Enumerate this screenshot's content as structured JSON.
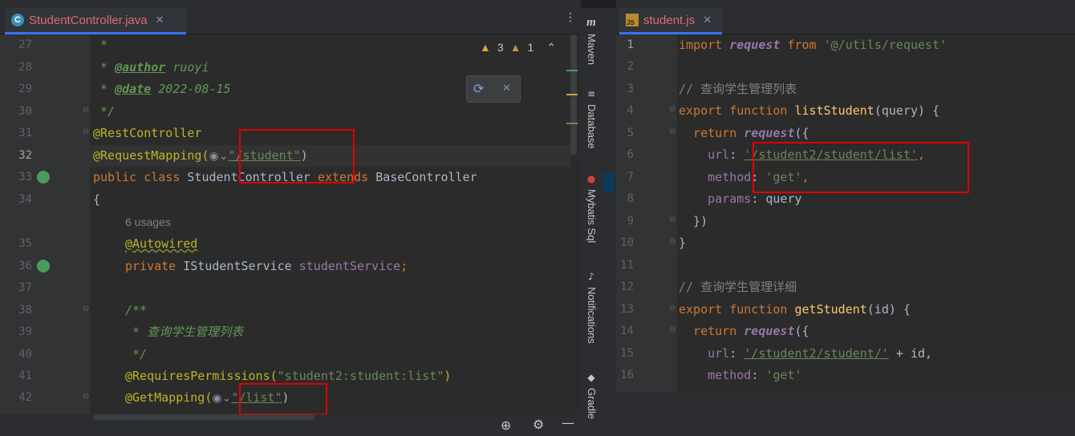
{
  "left_tab": {
    "label": "StudentController.java",
    "close": "✕"
  },
  "right_tab": {
    "label": "student.js",
    "close": "✕"
  },
  "inspections": {
    "warnings": "3",
    "weak_warnings": "1"
  },
  "sidebar": {
    "maven": "Maven",
    "database": "Database",
    "mybatis": "Mybatis Sql",
    "notifications": "Notifications",
    "gradle": "Gradle"
  },
  "java_lines": [
    {
      "n": "27"
    },
    {
      "n": "28"
    },
    {
      "n": "29"
    },
    {
      "n": "30"
    },
    {
      "n": "31"
    },
    {
      "n": "32"
    },
    {
      "n": "33"
    },
    {
      "n": "34"
    },
    {
      "n": ""
    },
    {
      "n": "35"
    },
    {
      "n": "36"
    },
    {
      "n": "37"
    },
    {
      "n": "38"
    },
    {
      "n": "39"
    },
    {
      "n": "40"
    },
    {
      "n": "41"
    },
    {
      "n": "42"
    }
  ],
  "java": {
    "l27": " *",
    "l28_pre": " * ",
    "l28_tag": "@author",
    "l28_val": " ruoyi",
    "l29_pre": " * ",
    "l29_tag": "@date",
    "l29_val": " 2022-08-15",
    "l30": " */",
    "l31": "@RestController",
    "l32_ann": "@RequestMapping(",
    "l32_str": "\"/student\"",
    "l32_end": ")",
    "l33_kw": "public class ",
    "l33_name": "StudentController ",
    "l33_ext": "extends ",
    "l33_base": "BaseController",
    "l34": "{",
    "usages": "6 usages",
    "l35": "@Autowired",
    "l36_kw": "private ",
    "l36_type": "IStudentService ",
    "l36_field": "studentService",
    "l36_end": ";",
    "l38": "/**",
    "l39": " * 查询学生管理列表",
    "l40": " */",
    "l41_ann": "@RequiresPermissions(",
    "l41_str": "\"student2:student:list\"",
    "l41_end": ")",
    "l42_ann": "@GetMapping(",
    "l42_str": "\"/list\"",
    "l42_end": ")"
  },
  "js_lines": [
    "1",
    "2",
    "3",
    "4",
    "5",
    "6",
    "7",
    "8",
    "9",
    "10",
    "11",
    "12",
    "13",
    "14",
    "15",
    "16"
  ],
  "js": {
    "l1_a": "import ",
    "l1_b": "request",
    "l1_c": " from ",
    "l1_d": "'@/utils/request'",
    "l3": "// 查询学生管理列表",
    "l4_a": "export function ",
    "l4_b": "listStudent",
    "l4_c": "(query) {",
    "l5_a": "  return ",
    "l5_b": "request",
    "l5_c": "({",
    "l6_a": "    url",
    "l6_b": ": ",
    "l6_c": "'/student2/student/list'",
    "l6_d": ",",
    "l7_a": "    method",
    "l7_b": ": ",
    "l7_c": "'get'",
    "l7_d": ",",
    "l8_a": "    params",
    "l8_b": ": query",
    "l9": "  })",
    "l10": "}",
    "l12": "// 查询学生管理详细",
    "l13_a": "export function ",
    "l13_b": "getStudent",
    "l13_c": "(id) {",
    "l14_a": "  return ",
    "l14_b": "request",
    "l14_c": "({",
    "l15_a": "    url",
    "l15_b": ": ",
    "l15_c": "'/student2/student/'",
    "l15_d": " + id,",
    "l16_a": "    method",
    "l16_b": ": ",
    "l16_c": "'get'"
  }
}
